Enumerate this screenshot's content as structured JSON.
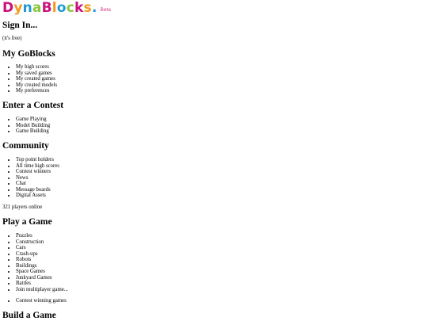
{
  "header": {
    "logo_letters": [
      {
        "ch": "D",
        "color": "#c8127d"
      },
      {
        "ch": "y",
        "color": "#f29a1c"
      },
      {
        "ch": "n",
        "color": "#1f9ad6"
      },
      {
        "ch": "a",
        "color": "#8cc63f"
      },
      {
        "ch": "B",
        "color": "#c8127d"
      },
      {
        "ch": "l",
        "color": "#f29a1c"
      },
      {
        "ch": "o",
        "color": "#1f9ad6"
      },
      {
        "ch": "c",
        "color": "#8cc63f"
      },
      {
        "ch": "k",
        "color": "#c8127d"
      },
      {
        "ch": "s",
        "color": "#f29a1c"
      },
      {
        "ch": ".",
        "color": "#1f9ad6"
      }
    ],
    "logo_text": "DynaBlocks.",
    "beta_label": "Beta"
  },
  "signin": {
    "heading": "Sign In...",
    "note": "(it's free)"
  },
  "mygoblocks": {
    "heading": "My GoBlocks",
    "items": [
      "My high scores",
      "My saved games",
      "My created games",
      "My created models",
      "My preferences"
    ]
  },
  "contest": {
    "heading": "Enter a Contest",
    "items": [
      "Game Playing",
      "Model Building",
      "Game Building"
    ]
  },
  "community": {
    "heading": "Community",
    "items": [
      "Top point holders",
      "All time high scores",
      "Contest winners",
      "News",
      "Chat",
      "Message boards",
      "Digital Assets"
    ],
    "players_online": "321 players online"
  },
  "play": {
    "heading": "Play a Game",
    "items": [
      "Puzzles",
      "Construction",
      "Cars",
      "Crash-ups",
      "Robots",
      "Buildings",
      "Space Games",
      "Junkyard Games",
      "Battles",
      "Join multiplayer game..."
    ],
    "extra_items": [
      "Contest winning games"
    ]
  },
  "build": {
    "heading": "Build a Game"
  }
}
